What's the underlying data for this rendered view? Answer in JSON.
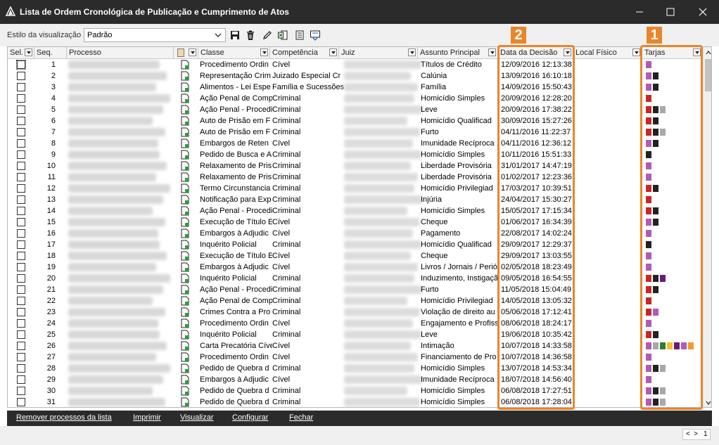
{
  "window": {
    "title": "Lista de Ordem Cronológica de Publicação e Cumprimento de Atos"
  },
  "toolbar": {
    "style_label": "Estilo da visualização",
    "style_value": "Padrão",
    "icons": [
      "save-icon",
      "delete-icon",
      "edit-icon",
      "export-excel-icon",
      "document-icon",
      "refresh-icon"
    ]
  },
  "columns": [
    {
      "id": "sel",
      "label": "Sel."
    },
    {
      "id": "seq",
      "label": "Seq."
    },
    {
      "id": "processo",
      "label": "Processo"
    },
    {
      "id": "docicon",
      "label": ""
    },
    {
      "id": "classe",
      "label": "Classe"
    },
    {
      "id": "competencia",
      "label": "Competência"
    },
    {
      "id": "juiz",
      "label": "Juiz"
    },
    {
      "id": "assunto",
      "label": "Assunto Principal"
    },
    {
      "id": "data",
      "label": "Data da Decisão"
    },
    {
      "id": "local",
      "label": "Local Físico"
    },
    {
      "id": "tarjas",
      "label": "Tarjas"
    }
  ],
  "tarja_colors": {
    "p": "#b05bb5",
    "r": "#c62828",
    "k": "#222222",
    "g": "#a8a8a8",
    "v": "#6a1b7a",
    "e": "#2e7d32",
    "y": "#f2c12e",
    "o": "#f39a2b"
  },
  "highlight": {
    "color": "#e8862a",
    "badge_1": "1",
    "badge_2": "2"
  },
  "rows": [
    {
      "seq": "1",
      "classe": "Procedimento Ordin",
      "comp": "Cível",
      "assunto": "Títulos de Crédito",
      "data": "12/09/2016 12:13:38",
      "tarjas": "p"
    },
    {
      "seq": "2",
      "classe": "Representação Crim",
      "comp": "Juizado Especial Cr",
      "assunto": "Calúnia",
      "data": "13/09/2016 16:10:18",
      "tarjas": "pk"
    },
    {
      "seq": "3",
      "classe": "Alimentos - Lei Espe",
      "comp": "Família e Sucessões",
      "assunto": "Família",
      "data": "14/09/2016 15:50:43",
      "tarjas": "pk"
    },
    {
      "seq": "4",
      "classe": "Ação Penal de Comp",
      "comp": "Criminal",
      "assunto": "Homicídio Simples",
      "data": "20/09/2016 12:28:20",
      "tarjas": "r"
    },
    {
      "seq": "5",
      "classe": "Ação Penal - Procedi",
      "comp": "Criminal",
      "assunto": "Leve",
      "data": "20/09/2016 17:38:22",
      "tarjas": "rkg"
    },
    {
      "seq": "6",
      "classe": "Auto de Prisão em F",
      "comp": "Criminal",
      "assunto": "Homicídio Qualificad",
      "data": "30/09/2016 15:27:26",
      "tarjas": "rk"
    },
    {
      "seq": "7",
      "classe": "Auto de Prisão em F",
      "comp": "Criminal",
      "assunto": "Furto",
      "data": "04/11/2016 11:22:37",
      "tarjas": "rkg"
    },
    {
      "seq": "8",
      "classe": "Embargos de Reten",
      "comp": "Cível",
      "assunto": "Imunidade Recíproca",
      "data": "04/11/2016 12:36:12",
      "tarjas": "pk"
    },
    {
      "seq": "9",
      "classe": "Pedido de Busca e A",
      "comp": "Criminal",
      "assunto": "Homicídio Simples",
      "data": "10/11/2016 15:51:33",
      "tarjas": "k"
    },
    {
      "seq": "10",
      "classe": "Relaxamento de Pris",
      "comp": "Criminal",
      "assunto": "Liberdade Provisória",
      "data": "31/01/2017 14:47:19",
      "tarjas": "p"
    },
    {
      "seq": "11",
      "classe": "Relaxamento de Pris",
      "comp": "Criminal",
      "assunto": "Liberdade Provisória",
      "data": "01/02/2017 12:23:36",
      "tarjas": "p"
    },
    {
      "seq": "12",
      "classe": "Termo Circunstancia",
      "comp": "Criminal",
      "assunto": "Homicídio Privilegiad",
      "data": "17/03/2017 10:39:51",
      "tarjas": "rk"
    },
    {
      "seq": "13",
      "classe": "Notificação para Exp",
      "comp": "Criminal",
      "assunto": "Injúria",
      "data": "24/04/2017 15:30:27",
      "tarjas": "r"
    },
    {
      "seq": "14",
      "classe": "Ação Penal - Procedi",
      "comp": "Criminal",
      "assunto": "Homicídio Simples",
      "data": "15/05/2017 17:15:34",
      "tarjas": "rk"
    },
    {
      "seq": "15",
      "classe": "Execução de Título E",
      "comp": "Cível",
      "assunto": "Cheque",
      "data": "01/06/2017 16:34:39",
      "tarjas": "pk"
    },
    {
      "seq": "16",
      "classe": "Embargos à Adjudic",
      "comp": "Cível",
      "assunto": "Pagamento",
      "data": "22/08/2017 14:02:24",
      "tarjas": "p"
    },
    {
      "seq": "17",
      "classe": "Inquérito Policial",
      "comp": "Criminal",
      "assunto": "Homicídio Qualificad",
      "data": "29/09/2017 12:29:37",
      "tarjas": "k"
    },
    {
      "seq": "18",
      "classe": "Execução de Título E",
      "comp": "Cível",
      "assunto": "Cheque",
      "data": "29/09/2017 13:03:55",
      "tarjas": "p"
    },
    {
      "seq": "19",
      "classe": "Embargos à Adjudic",
      "comp": "Cível",
      "assunto": "Livros / Jornais / Perió",
      "data": "02/05/2018 18:23:49",
      "tarjas": "p"
    },
    {
      "seq": "20",
      "classe": "Inquérito Policial",
      "comp": "Criminal",
      "assunto": "Induzimento, Instigaçã",
      "data": "09/05/2018 16:54:55",
      "tarjas": "rkv"
    },
    {
      "seq": "21",
      "classe": "Ação Penal - Procedi",
      "comp": "Criminal",
      "assunto": "Furto",
      "data": "11/05/2018 15:04:49",
      "tarjas": "rk"
    },
    {
      "seq": "22",
      "classe": "Ação Penal de Comp",
      "comp": "Criminal",
      "assunto": "Homicídio Privilegiad",
      "data": "14/05/2018 13:05:32",
      "tarjas": "r"
    },
    {
      "seq": "23",
      "classe": "Crimes Contra a Pro",
      "comp": "Criminal",
      "assunto": "Violação de direito au",
      "data": "05/06/2018 17:12:41",
      "tarjas": "rp"
    },
    {
      "seq": "24",
      "classe": "Procedimento Ordin",
      "comp": "Cível",
      "assunto": "Engajamento e Profiss",
      "data": "08/06/2018 18:24:17",
      "tarjas": "p"
    },
    {
      "seq": "25",
      "classe": "Inquérito Policial",
      "comp": "Criminal",
      "assunto": "Leve",
      "data": "19/06/2018 10:35:42",
      "tarjas": "rk"
    },
    {
      "seq": "26",
      "classe": "Carta Precatória Cíve",
      "comp": "Cível",
      "assunto": "Intimação",
      "data": "10/07/2018 14:33:58",
      "tarjas": "pgeyvpo"
    },
    {
      "seq": "27",
      "classe": "Procedimento Ordin",
      "comp": "Cível",
      "assunto": "Financiamento de Pro",
      "data": "10/07/2018 14:36:58",
      "tarjas": "p"
    },
    {
      "seq": "28",
      "classe": "Pedido de Quebra d",
      "comp": "Criminal",
      "assunto": "Homicídio Simples",
      "data": "13/07/2018 14:53:34",
      "tarjas": "pkg"
    },
    {
      "seq": "29",
      "classe": "Embargos à Adjudic",
      "comp": "Cível",
      "assunto": "Imunidade Recíproca",
      "data": "18/07/2018 14:56:40",
      "tarjas": "p"
    },
    {
      "seq": "30",
      "classe": "Pedido de Quebra d",
      "comp": "Criminal",
      "assunto": "Homicídio Simples",
      "data": "06/08/2018 17:27:51",
      "tarjas": "pkg"
    },
    {
      "seq": "31",
      "classe": "Pedido de Quebra d",
      "comp": "Criminal",
      "assunto": "Homicídio Simples",
      "data": "06/08/2018 17:28:04",
      "tarjas": "pkg"
    }
  ],
  "bottom_actions": [
    "Remover processos da lista",
    "Imprimir",
    "Visualizar",
    "Configurar",
    "Fechar"
  ],
  "pager": {
    "page": "1"
  }
}
